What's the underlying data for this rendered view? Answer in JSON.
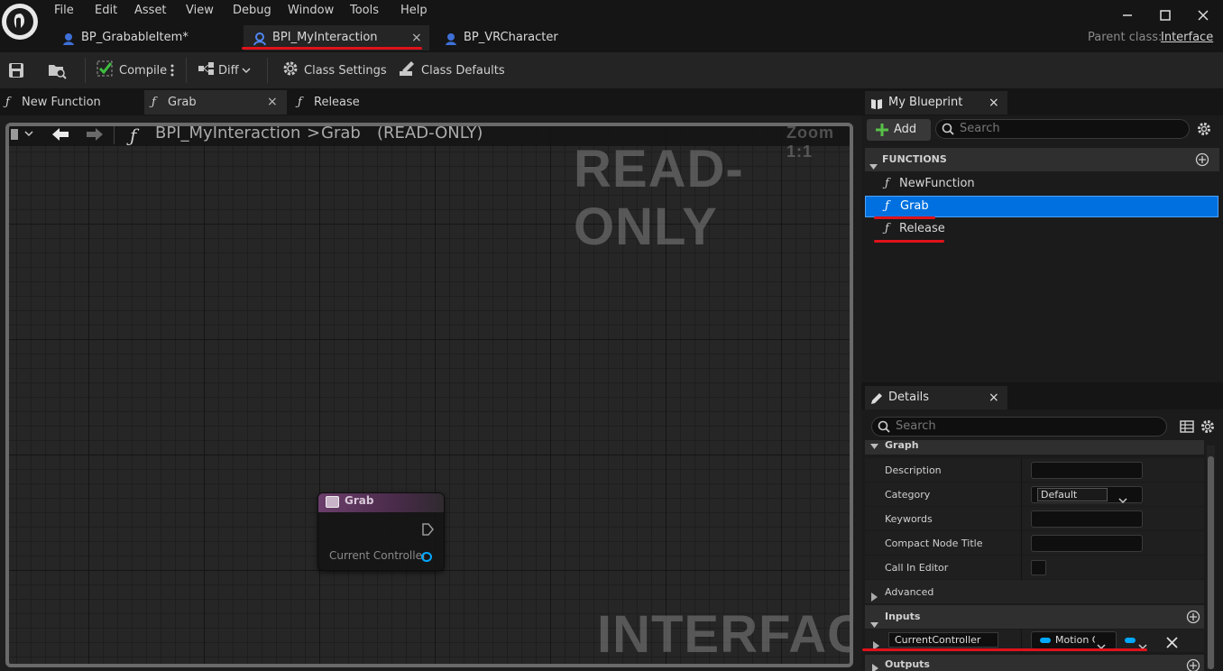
{
  "menu": [
    "File",
    "Edit",
    "Asset",
    "View",
    "Debug",
    "Window",
    "Tools",
    "Help"
  ],
  "doc_tabs": [
    {
      "label": "BP_GrabableItem*"
    },
    {
      "label": "BPI_MyInteraction",
      "close": "×"
    },
    {
      "label": "BP_VRCharacter"
    }
  ],
  "parent_class": {
    "label": "Parent class:",
    "value": "Interface"
  },
  "toolbar": {
    "compile": "Compile",
    "diff": "Diff",
    "class_settings": "Class Settings",
    "class_defaults": "Class Defaults"
  },
  "function_tabs": [
    {
      "label": "New Function"
    },
    {
      "label": "Grab",
      "close": "×"
    },
    {
      "label": "Release"
    }
  ],
  "graph": {
    "breadcrumb_root": "BPI_MyInteraction",
    "breadcrumb_sep": ">",
    "breadcrumb_current": "Grab",
    "mode": "(READ-ONLY)",
    "zoom": "Zoom 1:1",
    "watermark_top": "READ-ONLY",
    "watermark_bottom": "INTERFACE",
    "node": {
      "title": "Grab",
      "pin": "Current Controller"
    }
  },
  "my_blueprint": {
    "tab": "My Blueprint",
    "close": "×",
    "add": "Add",
    "search_placeholder": "Search",
    "section": "FUNCTIONS",
    "functions": [
      "NewFunction",
      "Grab",
      "Release"
    ]
  },
  "details": {
    "tab": "Details",
    "close": "×",
    "search_placeholder": "Search",
    "graph_section": "Graph",
    "rows": {
      "description": "Description",
      "category": "Category",
      "category_value": "Default",
      "keywords": "Keywords",
      "compact_title": "Compact Node Title",
      "call_in_editor": "Call In Editor",
      "advanced": "Advanced"
    },
    "inputs_section": "Inputs",
    "input_name": "CurrentController",
    "input_type": "Motion C",
    "outputs_section": "Outputs"
  },
  "colors": {
    "accent_blue": "#0070e0",
    "underline_red": "#e0121b",
    "pin_cyan": "#00a8ff"
  }
}
